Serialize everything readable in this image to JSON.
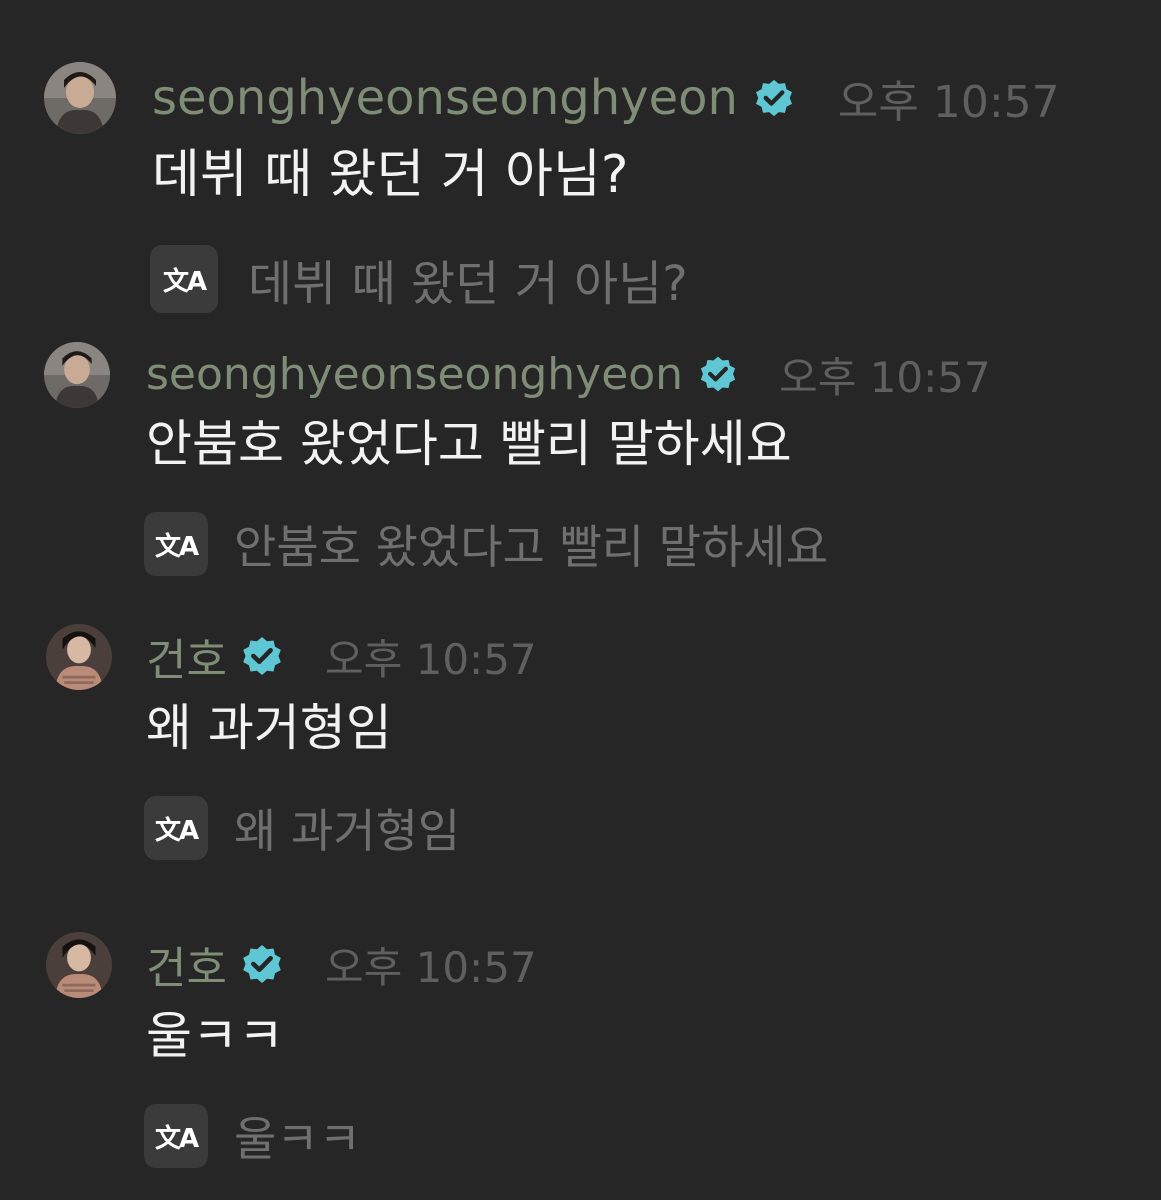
{
  "colors": {
    "background": "#262626",
    "username": "#7f8d76",
    "verified_badge": "#5fc7d4",
    "timestamp": "#5f5f5f",
    "message_text": "#f2f2f2",
    "translated_text": "#6f6f6f",
    "translate_button": "#3b3b3b"
  },
  "translate_icon": {
    "icon": "translate-icon",
    "glyph": "文A"
  },
  "verified_icon": "verified-badge-icon",
  "messages": [
    {
      "username": "seonghyeonseonghyeon",
      "verified": true,
      "time": "오후 10:57",
      "text": "데뷔 때 왔던 거 아님?",
      "translation": "데뷔 때 왔던 거 아님?"
    },
    {
      "username": "seonghyeonseonghyeon",
      "verified": true,
      "time": "오후 10:57",
      "text": "안붐호 왔었다고 빨리 말하세요",
      "translation": "안붐호 왔었다고 빨리 말하세요"
    },
    {
      "username": "건호",
      "verified": true,
      "time": "오후 10:57",
      "text": "왜 과거형임",
      "translation": "왜 과거형임"
    },
    {
      "username": "건호",
      "verified": true,
      "time": "오후 10:57",
      "text": "울ㅋㅋ",
      "translation": "울ㅋㅋ"
    }
  ]
}
